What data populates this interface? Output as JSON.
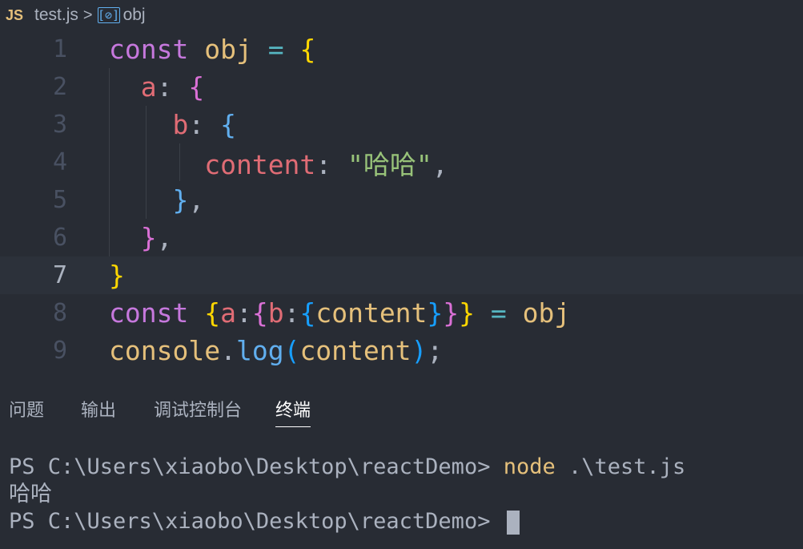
{
  "breadcrumb": {
    "lang_badge": "JS",
    "file": "test.js",
    "separator": ">",
    "symbol_icon": "[⊘]",
    "symbol": "obj"
  },
  "editor": {
    "line_numbers": [
      "1",
      "2",
      "3",
      "4",
      "5",
      "6",
      "7",
      "8",
      "9"
    ],
    "active_line": "7",
    "lines": [
      [
        [
          "kw",
          "const"
        ],
        [
          "punc",
          " "
        ],
        [
          "var",
          "obj"
        ],
        [
          "punc",
          " "
        ],
        [
          "op",
          "="
        ],
        [
          "punc",
          " "
        ],
        [
          "b1",
          "{"
        ]
      ],
      [
        [
          "punc",
          "  "
        ],
        [
          "prop",
          "a"
        ],
        [
          "punc",
          ": "
        ],
        [
          "b2",
          "{"
        ]
      ],
      [
        [
          "punc",
          "    "
        ],
        [
          "prop",
          "b"
        ],
        [
          "punc",
          ": "
        ],
        [
          "b3l",
          "{"
        ]
      ],
      [
        [
          "punc",
          "      "
        ],
        [
          "prop",
          "content"
        ],
        [
          "punc",
          ": "
        ],
        [
          "str",
          "\"哈哈\""
        ],
        [
          "punc",
          ","
        ]
      ],
      [
        [
          "punc",
          "    "
        ],
        [
          "b3l",
          "}"
        ],
        [
          "punc",
          ","
        ]
      ],
      [
        [
          "punc",
          "  "
        ],
        [
          "b2",
          "}"
        ],
        [
          "punc",
          ","
        ]
      ],
      [
        [
          "b1",
          "}"
        ]
      ],
      [
        [
          "kw",
          "const"
        ],
        [
          "punc",
          " "
        ],
        [
          "b1",
          "{"
        ],
        [
          "prop",
          "a"
        ],
        [
          "punc",
          ":"
        ],
        [
          "b2",
          "{"
        ],
        [
          "prop",
          "b"
        ],
        [
          "punc",
          ":"
        ],
        [
          "b3",
          "{"
        ],
        [
          "obj",
          "content"
        ],
        [
          "b3",
          "}"
        ],
        [
          "b2",
          "}"
        ],
        [
          "b1",
          "}"
        ],
        [
          "punc",
          " "
        ],
        [
          "op",
          "="
        ],
        [
          "punc",
          " "
        ],
        [
          "var",
          "obj"
        ]
      ],
      [
        [
          "obj",
          "console"
        ],
        [
          "punc",
          "."
        ],
        [
          "fn",
          "log"
        ],
        [
          "b3",
          "("
        ],
        [
          "obj",
          "content"
        ],
        [
          "b3",
          ")"
        ],
        [
          "punc",
          ";"
        ]
      ]
    ]
  },
  "panel": {
    "tabs": [
      "问题",
      "输出",
      "调试控制台",
      "终端"
    ],
    "active_tab": "终端",
    "terminal": {
      "line1_prompt": "PS C:\\Users\\xiaobo\\Desktop\\reactDemo> ",
      "line1_cmd": "node",
      "line1_arg": " .\\test.js",
      "line2": "哈哈",
      "line3_prompt": "PS C:\\Users\\xiaobo\\Desktop\\reactDemo> "
    }
  },
  "colors": {
    "background": "#282c34",
    "active_line": "#2c313a",
    "keyword": "#c678dd",
    "string": "#98c379",
    "property": "#e06c75"
  }
}
